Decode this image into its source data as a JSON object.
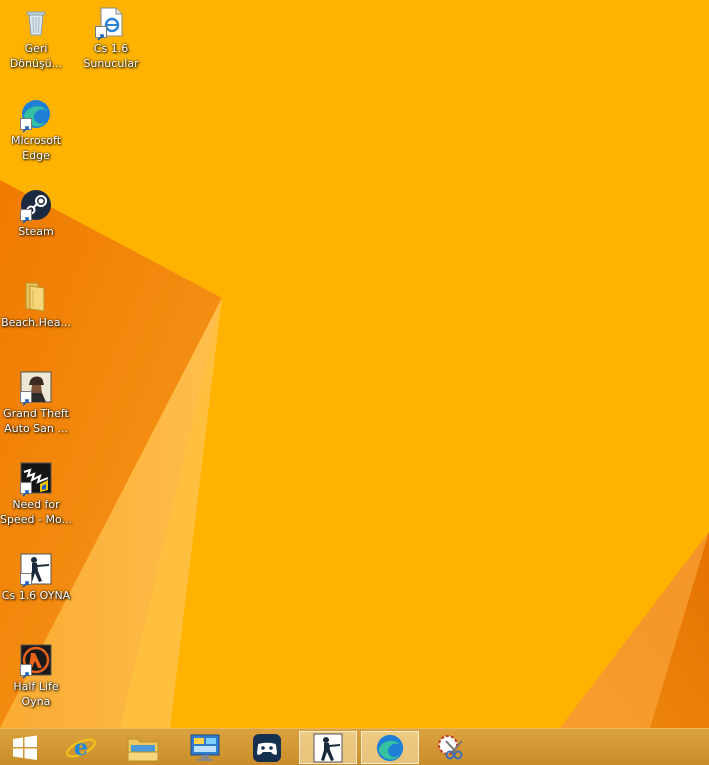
{
  "desktop": {
    "icons": [
      {
        "name": "recycle-bin",
        "label": "Geri\nDönüşü..."
      },
      {
        "name": "cs16-servers",
        "label": "Cs 1.6\nSunucular"
      },
      {
        "name": "microsoft-edge",
        "label": "Microsoft\nEdge"
      },
      {
        "name": "steam",
        "label": "Steam"
      },
      {
        "name": "beach-head-folder",
        "label": "Beach.Hea..."
      },
      {
        "name": "gta-san-andreas",
        "label": "Grand Theft\nAuto San ..."
      },
      {
        "name": "need-for-speed",
        "label": "Need for\nSpeed - Mo..."
      },
      {
        "name": "cs16-play",
        "label": "Cs 1.6 OYNA"
      },
      {
        "name": "half-life-play",
        "label": "Half Life\nOyna"
      }
    ]
  },
  "taskbar": {
    "buttons": [
      {
        "name": "start",
        "icon": "windows-logo-icon"
      },
      {
        "name": "internet-explorer",
        "icon": "internet-explorer-icon"
      },
      {
        "name": "file-explorer",
        "icon": "file-explorer-icon"
      },
      {
        "name": "control-panel",
        "icon": "control-panel-icon"
      },
      {
        "name": "gamepad-app",
        "icon": "gamepad-icon"
      },
      {
        "name": "counter-strike",
        "icon": "counter-strike-icon",
        "active": true
      },
      {
        "name": "microsoft-edge",
        "icon": "edge-icon",
        "active": true
      },
      {
        "name": "snipping-tool",
        "icon": "snipping-tool-icon"
      }
    ]
  },
  "colors": {
    "wallpaper_base": "#ffb300",
    "wallpaper_dark": "#ef7d00",
    "taskbar": "#d39a35"
  }
}
